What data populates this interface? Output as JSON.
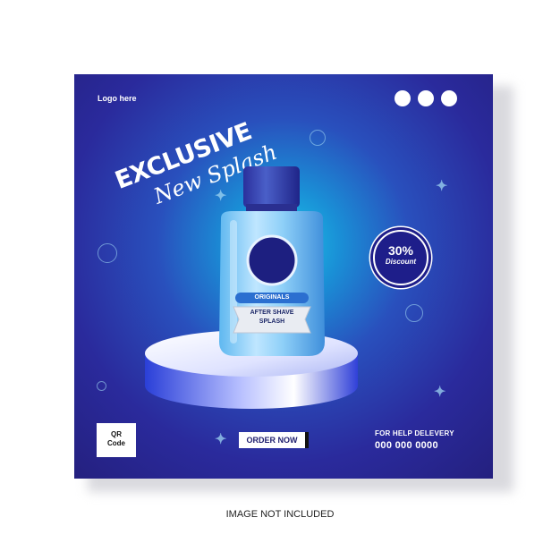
{
  "header": {
    "logo_text": "Logo here",
    "menu_dots_icon": "three-dots-icon"
  },
  "headline": {
    "line1": "EXCLUSIVE",
    "line2": "New Splash"
  },
  "badge": {
    "percent": "30%",
    "label": "Discount"
  },
  "product": {
    "label_top": "ORIGINALS",
    "label_line1": "AFTER SHAVE",
    "label_line2": "SPLASH"
  },
  "footer": {
    "qr_line1": "QR",
    "qr_line2": "Code",
    "order_button": "ORDER NOW",
    "help_label": "FOR HELP DELEVERY",
    "help_phone": "000 000 0000"
  },
  "note": "IMAGE NOT INCLUDED",
  "colors": {
    "card_dark": "#24207f",
    "card_glow": "#19c6e8",
    "accent_white": "#ffffff"
  }
}
